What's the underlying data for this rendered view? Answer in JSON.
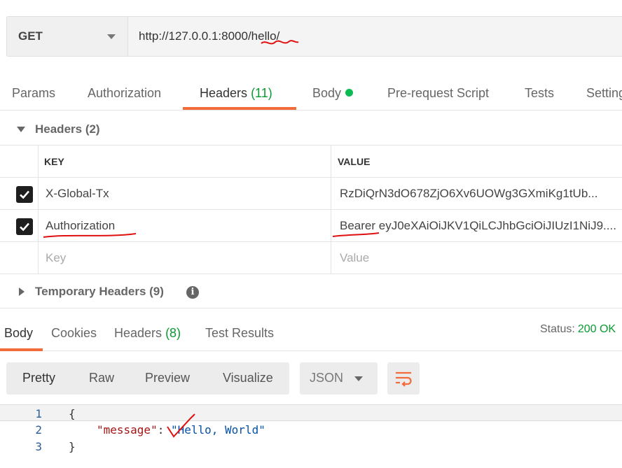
{
  "request": {
    "method": "GET",
    "url": "http://127.0.0.1:8000/hello/"
  },
  "request_tabs": [
    {
      "label": "Params"
    },
    {
      "label": "Authorization"
    },
    {
      "label": "Headers",
      "count": "(11)"
    },
    {
      "label": "Body"
    },
    {
      "label": "Pre-request Script"
    },
    {
      "label": "Tests"
    },
    {
      "label": "Settings"
    }
  ],
  "headers_section": {
    "title": "Headers (2)",
    "columns": {
      "key": "KEY",
      "value": "VALUE"
    },
    "rows": [
      {
        "key": "X-Global-Tx",
        "value": "RzDiQrN3dO678ZjO6Xv6UOWg3GXmiKg1tUb...",
        "checked": true
      },
      {
        "key": "Authorization",
        "value": "Bearer eyJ0eXAiOiJKV1QiLCJhbGciOiJIUzI1NiJ9....",
        "checked": true
      }
    ],
    "placeholder_key": "Key",
    "placeholder_value": "Value"
  },
  "temporary_headers": {
    "title": "Temporary Headers (9)"
  },
  "response_tabs": [
    {
      "label": "Body"
    },
    {
      "label": "Cookies"
    },
    {
      "label": "Headers",
      "count": "(8)"
    },
    {
      "label": "Test Results"
    }
  ],
  "status": {
    "label": "Status:",
    "value": "200 OK"
  },
  "view_modes": [
    "Pretty",
    "Raw",
    "Preview",
    "Visualize"
  ],
  "format": "JSON",
  "code": {
    "line_numbers": [
      "1",
      "2",
      "3"
    ],
    "open_brace": "{",
    "key": "\"message\"",
    "colon": ": ",
    "value": "\"Hello, World\"",
    "close_brace": "}"
  },
  "colors": {
    "accent": "#f26b3a",
    "success": "#0a9a33",
    "annotation": "#e01010"
  }
}
